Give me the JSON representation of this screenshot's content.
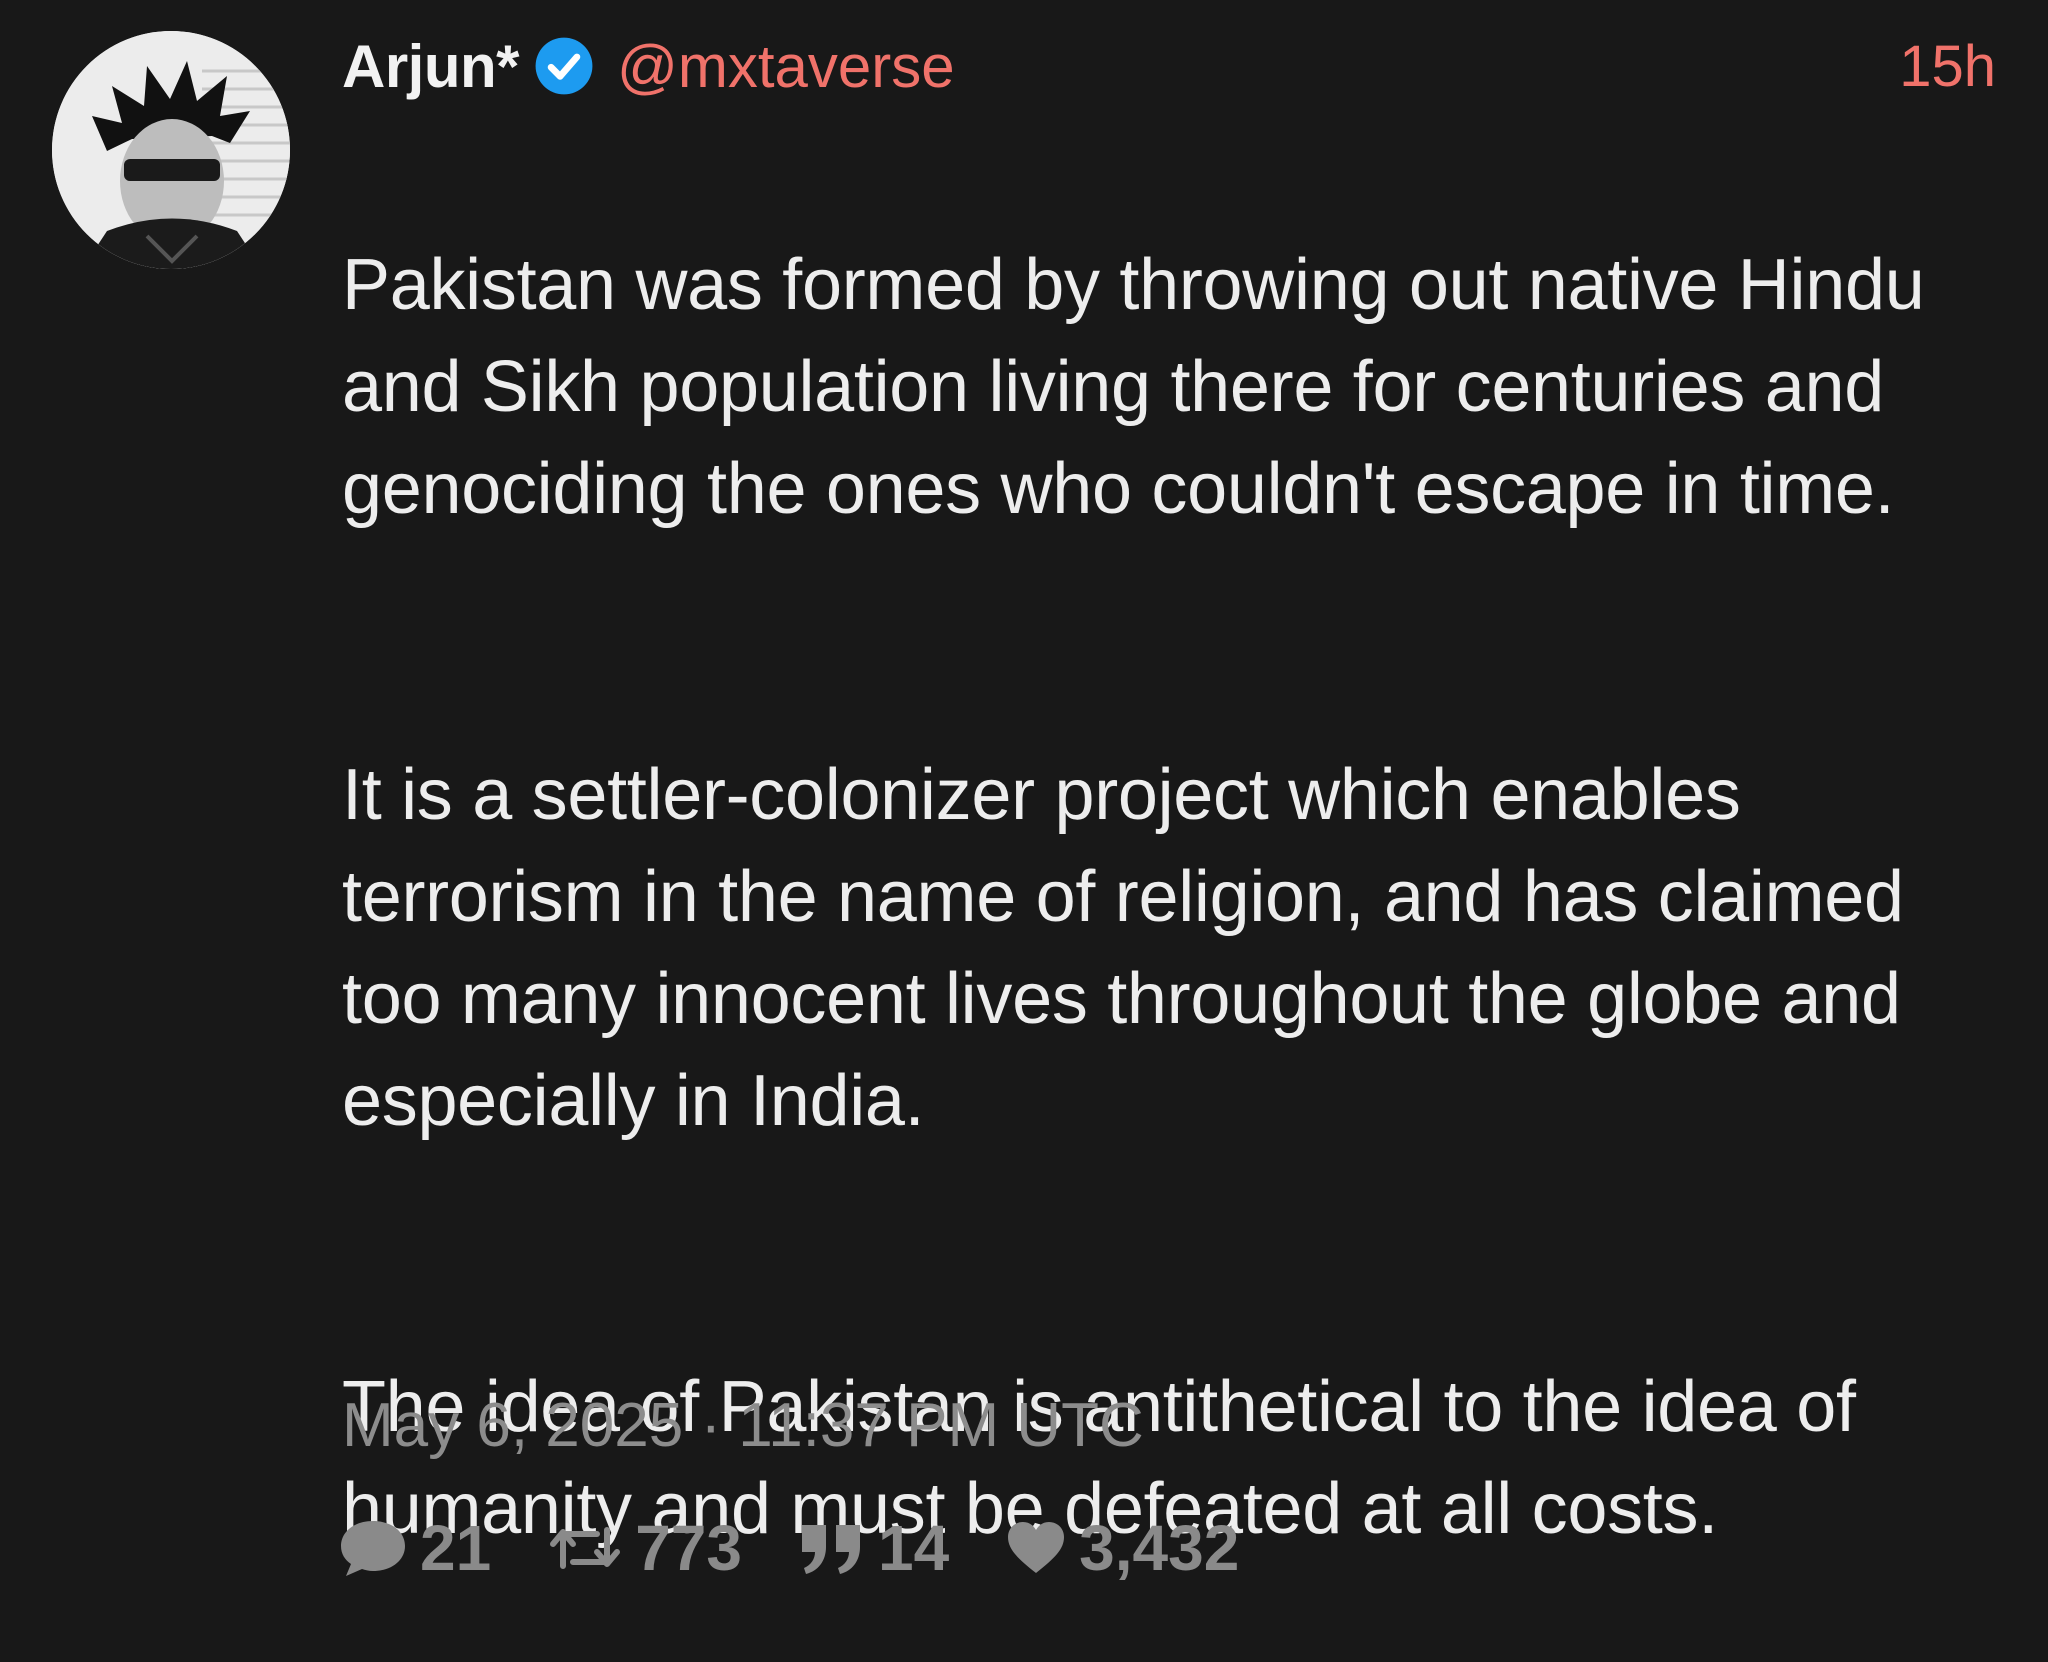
{
  "post": {
    "author": {
      "display_name": "Arjun*",
      "handle": "@mxtaverse",
      "verified": true,
      "avatar_icon": "avatar-photo"
    },
    "time_ago": "15h",
    "paragraphs": [
      "Pakistan was formed by throwing out native Hindu and Sikh population living there for centuries and genociding the ones who couldn't escape in time.",
      "It is a settler-colonizer project which enables terrorism in the name of religion, and has claimed too many innocent lives throughout the globe and especially in India.",
      "The idea of Pakistan is antithetical to the idea of humanity and must be defeated at all costs."
    ],
    "timestamp": "May 6, 2025 · 11:37 PM UTC",
    "stats": {
      "replies": "21",
      "retweets": "773",
      "quotes": "14",
      "likes": "3,432"
    }
  },
  "colors": {
    "background": "#181818",
    "accent": "#f0726a",
    "verified_blue": "#1d9bf0",
    "muted": "#8a8a8a"
  }
}
